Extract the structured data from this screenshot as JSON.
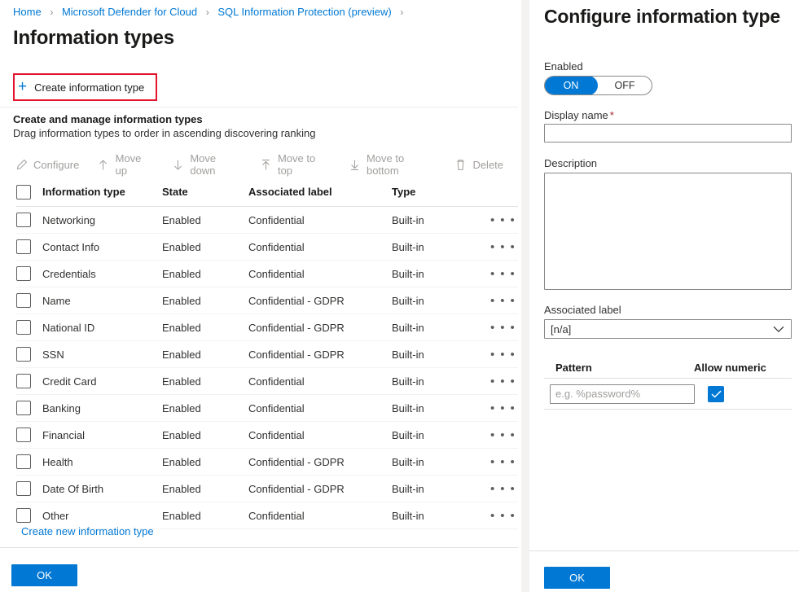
{
  "breadcrumb": {
    "items": [
      {
        "label": "Home"
      },
      {
        "label": "Microsoft Defender for Cloud"
      },
      {
        "label": "SQL Information Protection (preview)"
      }
    ],
    "separator": "›"
  },
  "page": {
    "title": "Information types"
  },
  "commandbar": {
    "create_label": "Create information type",
    "create_icon": "plus-icon",
    "highlight_color": "#e3142d"
  },
  "section": {
    "title": "Create and manage information types",
    "subtitle": "Drag information types to order in ascending discovering ranking"
  },
  "grid_toolbar": {
    "disabled": true,
    "items": [
      {
        "label": "Configure",
        "icon": "pencil-icon"
      },
      {
        "label": "Move up",
        "icon": "arrow-up-icon"
      },
      {
        "label": "Move down",
        "icon": "arrow-down-icon"
      },
      {
        "label": "Move to top",
        "icon": "arrow-to-top-icon"
      },
      {
        "label": "Move to bottom",
        "icon": "arrow-to-bottom-icon"
      },
      {
        "label": "Delete",
        "icon": "trash-icon"
      }
    ]
  },
  "table": {
    "columns": [
      "Information type",
      "State",
      "Associated label",
      "Type"
    ],
    "rows": [
      {
        "name": "Networking",
        "state": "Enabled",
        "label": "Confidential",
        "type": "Built-in"
      },
      {
        "name": "Contact Info",
        "state": "Enabled",
        "label": "Confidential",
        "type": "Built-in"
      },
      {
        "name": "Credentials",
        "state": "Enabled",
        "label": "Confidential",
        "type": "Built-in"
      },
      {
        "name": "Name",
        "state": "Enabled",
        "label": "Confidential - GDPR",
        "type": "Built-in"
      },
      {
        "name": "National ID",
        "state": "Enabled",
        "label": "Confidential - GDPR",
        "type": "Built-in"
      },
      {
        "name": "SSN",
        "state": "Enabled",
        "label": "Confidential - GDPR",
        "type": "Built-in"
      },
      {
        "name": "Credit Card",
        "state": "Enabled",
        "label": "Confidential",
        "type": "Built-in"
      },
      {
        "name": "Banking",
        "state": "Enabled",
        "label": "Confidential",
        "type": "Built-in"
      },
      {
        "name": "Financial",
        "state": "Enabled",
        "label": "Confidential",
        "type": "Built-in"
      },
      {
        "name": "Health",
        "state": "Enabled",
        "label": "Confidential - GDPR",
        "type": "Built-in"
      },
      {
        "name": "Date Of Birth",
        "state": "Enabled",
        "label": "Confidential - GDPR",
        "type": "Built-in"
      },
      {
        "name": "Other",
        "state": "Enabled",
        "label": "Confidential",
        "type": "Built-in"
      }
    ],
    "row_menu_glyph": "• • •",
    "create_new_link": "Create new information type"
  },
  "left_footer": {
    "ok_label": "OK"
  },
  "configure_panel": {
    "title": "Configure information type",
    "enabled": {
      "label": "Enabled",
      "on_label": "ON",
      "off_label": "OFF",
      "value": "ON"
    },
    "display_name": {
      "label": "Display name",
      "required_mark": "*",
      "value": "",
      "placeholder": ""
    },
    "description": {
      "label": "Description",
      "value": "",
      "placeholder": ""
    },
    "associated_label": {
      "label": "Associated label",
      "value": "[n/a]",
      "options": [
        "[n/a]"
      ]
    },
    "pattern_table": {
      "col_pattern": "Pattern",
      "col_allow_numeric": "Allow numeric",
      "rows": [
        {
          "pattern_value": "",
          "pattern_placeholder": "e.g. %password%",
          "allow_numeric": true
        }
      ]
    },
    "ok_label": "OK"
  },
  "colors": {
    "accent": "#0078d4",
    "link": "#0078d4",
    "highlight": "#e3142d",
    "required": "#a4262c",
    "disabled_text": "#a19f9d"
  }
}
